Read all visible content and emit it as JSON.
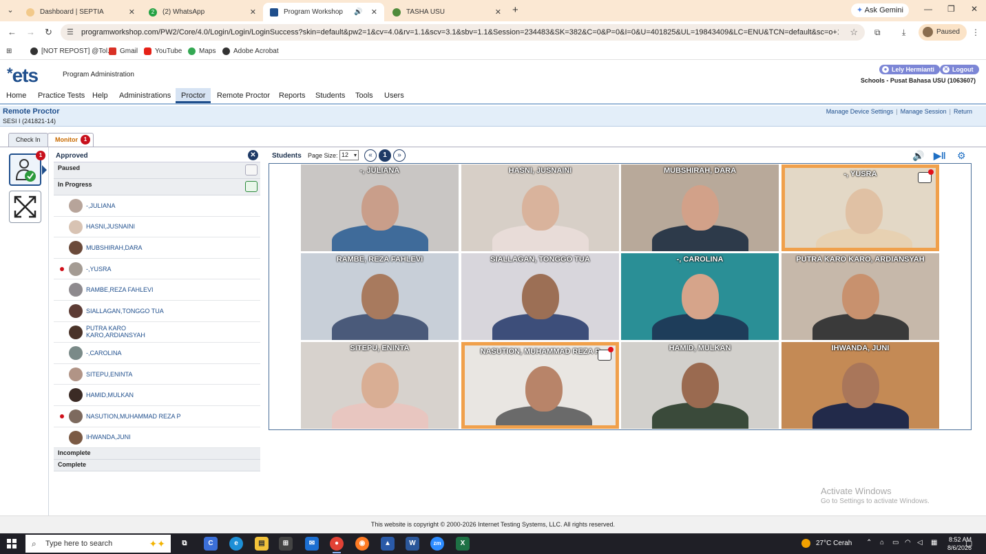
{
  "browser": {
    "tabs": [
      {
        "label": "Dashboard | SEPTIA",
        "active": false
      },
      {
        "label": "(2) WhatsApp",
        "badge": "2",
        "active": false
      },
      {
        "label": "Program Workshop",
        "active": true
      },
      {
        "label": "TASHA USU",
        "active": false
      }
    ],
    "new_tab": "+",
    "gemini_label": "Ask Gemini",
    "url": "programworkshop.com/PW2/Core/4.0/Login/Login/LoginSuccess?skin=default&pw2=1&cv=4.0&rv=1.1&scv=3.1&sbv=1.1&Session=234483&SK=382&C=0&P=0&I=0&U=401825&UL=19843409&LC=ENU&TCN=default&sc=o+1nl0ksQd...",
    "profile_label": "Paused",
    "bookmarks": [
      "[NOT REPOST] @Tol...",
      "Gmail",
      "YouTube",
      "Maps",
      "Adobe Acrobat"
    ]
  },
  "app": {
    "logo": "ets",
    "section": "Program Administration",
    "user_name": "Lely Hermianti",
    "logout": "Logout",
    "school": "Schools - Pusat Bahasa USU (1063607)",
    "nav": [
      "Home",
      "Practice Tests",
      "Help",
      "Administrations",
      "Proctor",
      "Remote Proctor",
      "Reports",
      "Students",
      "Tools",
      "Users"
    ],
    "nav_active": "Proctor",
    "page_title": "Remote Proctor",
    "session": "SESI I (241821-14)",
    "links": [
      "Manage Device Settings",
      "Manage Session",
      "Return"
    ],
    "subtabs": {
      "checkin": "Check In",
      "monitor": "Monitor",
      "monitor_badge": "1"
    },
    "rail_badge": "1"
  },
  "side": {
    "approved": "Approved",
    "paused": "Paused",
    "in_progress": "In Progress",
    "incomplete": "Incomplete",
    "complete": "Complete",
    "students": [
      {
        "name": "-,JULIANA",
        "flag": false
      },
      {
        "name": "HASNI,JUSNAINI",
        "flag": false
      },
      {
        "name": "MUBSHIRAH,DARA",
        "flag": false
      },
      {
        "name": "-,YUSRA",
        "flag": true
      },
      {
        "name": "RAMBE,REZA FAHLEVI",
        "flag": false
      },
      {
        "name": "SIALLAGAN,TONGGO TUA",
        "flag": false
      },
      {
        "name": "PUTRA KARO KARO,ARDIANSYAH",
        "flag": false
      },
      {
        "name": "-,CAROLINA",
        "flag": false
      },
      {
        "name": "SITEPU,ENINTA",
        "flag": false
      },
      {
        "name": "HAMID,MULKAN",
        "flag": false
      },
      {
        "name": "NASUTION,MUHAMMAD REZA P",
        "flag": true
      },
      {
        "name": "IHWANDA,JUNI",
        "flag": false
      }
    ]
  },
  "students_panel": {
    "title": "Students",
    "page_size_label": "Page Size:",
    "page_size": "12",
    "prev": "«",
    "current_page": "1",
    "next": "»",
    "tiles": [
      {
        "name": "-, JULIANA",
        "flag": false,
        "chat": false
      },
      {
        "name": "HASNI, JUSNAINI",
        "flag": false,
        "chat": false
      },
      {
        "name": "MUBSHIRAH, DARA",
        "flag": false,
        "chat": false
      },
      {
        "name": "-, YUSRA",
        "flag": true,
        "chat": true
      },
      {
        "name": "RAMBE, REZA FAHLEVI",
        "flag": false,
        "chat": false
      },
      {
        "name": "SIALLAGAN, TONGGO TUA",
        "flag": false,
        "chat": false
      },
      {
        "name": "-, CAROLINA",
        "flag": false,
        "chat": false
      },
      {
        "name": "PUTRA KARO KARO, ARDIANSYAH",
        "flag": false,
        "chat": false
      },
      {
        "name": "SITEPU, ENINTA",
        "flag": false,
        "chat": false
      },
      {
        "name": "NASUTION, MUHAMMAD REZA P",
        "flag": true,
        "chat": true
      },
      {
        "name": "HAMID, MULKAN",
        "flag": false,
        "chat": false
      },
      {
        "name": "IHWANDA, JUNI",
        "flag": false,
        "chat": false
      }
    ]
  },
  "watermark": {
    "line1": "Activate Windows",
    "line2": "Go to Settings to activate Windows."
  },
  "footer": "This website is copyright © 2000-2026 Internet Testing Systems, LLC. All rights reserved.",
  "taskbar": {
    "search_placeholder": "Type here to search",
    "weather": "27°C  Cerah",
    "time": "8:52 AM",
    "date": "8/6/2026"
  }
}
